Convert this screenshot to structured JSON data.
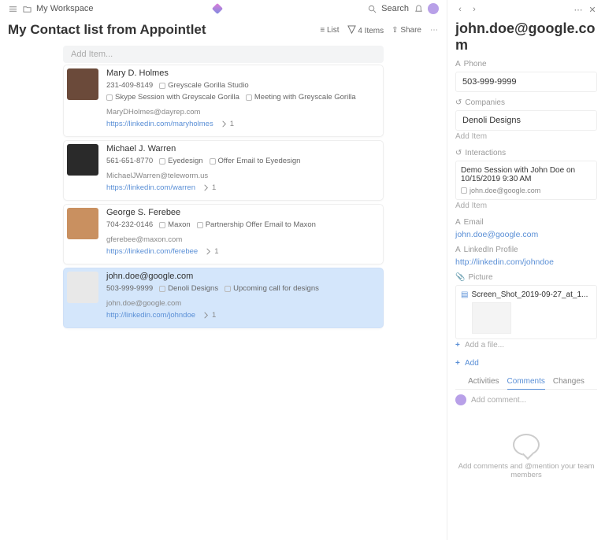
{
  "topbar": {
    "workspace": "My Workspace",
    "search": "Search"
  },
  "page": {
    "title": "My Contact list from Appointlet",
    "listLabel": "List",
    "itemsLabel": "4 Items",
    "shareLabel": "Share",
    "addItemPlaceholder": "Add Item..."
  },
  "contacts": [
    {
      "name": "Mary D. Holmes",
      "phone": "231-409-8149",
      "company": "Greyscale Gorilla Studio",
      "int1": "Skype Session with Greyscale Gorilla",
      "int2": "Meeting with Greyscale Gorilla",
      "email": "MaryDHolmes@dayrep.com",
      "linkedin": "https://linkedin.com/maryholmes",
      "pics": "1"
    },
    {
      "name": "Michael J. Warren",
      "phone": "561-651-8770",
      "company": "Eyedesign",
      "int1": "Offer Email to Eyedesign",
      "email": "MichaelJWarren@teleworm.us",
      "linkedin": "https://linkedin.com/warren",
      "pics": "1"
    },
    {
      "name": "George S. Ferebee",
      "phone": "704-232-0146",
      "company": "Maxon",
      "int1": "Partnership Offer Email to Maxon",
      "email": "gferebee@maxon.com",
      "linkedin": "https://linkedin.com/ferebee",
      "pics": "1"
    },
    {
      "name": "john.doe@google.com",
      "phone": "503-999-9999",
      "company": "Denoli Designs",
      "int1": "Upcoming call for designs",
      "email": "john.doe@google.com",
      "linkedin": "http://linkedin.com/johndoe",
      "pics": "1"
    }
  ],
  "detail": {
    "title": "john.doe@google.com",
    "phoneLabel": "Phone",
    "phone": "503-999-9999",
    "companiesLabel": "Companies",
    "company": "Denoli Designs",
    "addItem": "Add Item",
    "interactionsLabel": "Interactions",
    "interactionTitle": "Demo Session with John Doe on 10/15/2019 9:30 AM",
    "interactionSub": "john.doe@google.com",
    "emailLabel": "Email",
    "email": "john.doe@google.com",
    "linkedinLabel": "LinkedIn Profile",
    "linkedin": "http://linkedin.com/johndoe",
    "pictureLabel": "Picture",
    "filename": "Screen_Shot_2019-09-27_at_1...",
    "addFile": "Add a file...",
    "add": "Add",
    "tabs": {
      "activities": "Activities",
      "comments": "Comments",
      "changes": "Changes"
    },
    "commentPlaceholder": "Add comment...",
    "emptyMsg": "Add comments and @mention your team members"
  }
}
